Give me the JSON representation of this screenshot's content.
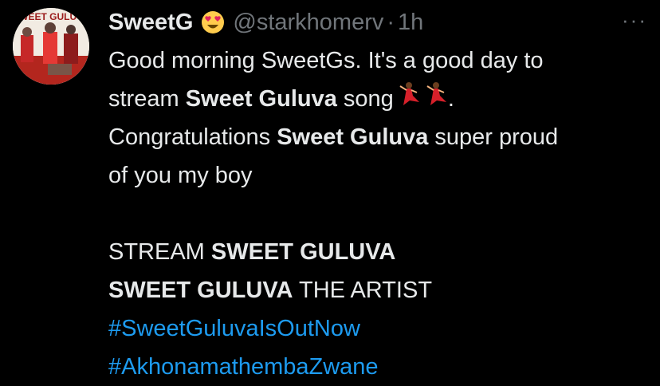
{
  "tweet": {
    "author_name": "SweetG",
    "author_emoji": "heart-eyes-emoji",
    "handle": "@starkhomerv",
    "separator": "·",
    "time": "1h",
    "more": "···",
    "avatar_text": "SWEET GULUVA",
    "line1": "Good morning SweetGs. It's a good day to",
    "line2_pre": "stream ",
    "line2_bold": "Sweet Guluva",
    "line2_post": " song",
    "line2_end": ".",
    "line3_pre": "Congratulations ",
    "line3_bold": "Sweet Guluva",
    "line3_post": " super proud",
    "line4": "of you my boy",
    "line5_pre": "STREAM ",
    "line5_bold": "SWEET GULUVA",
    "line6_bold": "SWEET GULUVA",
    "line6_post": " THE ARTIST",
    "hashtag1": "#SweetGuluvaIsOutNow",
    "hashtag2": "#AkhonamathembaZwane"
  },
  "colors": {
    "background": "#000000",
    "text": "#e7e9ea",
    "muted": "#71767b",
    "link": "#1d9bf0"
  }
}
